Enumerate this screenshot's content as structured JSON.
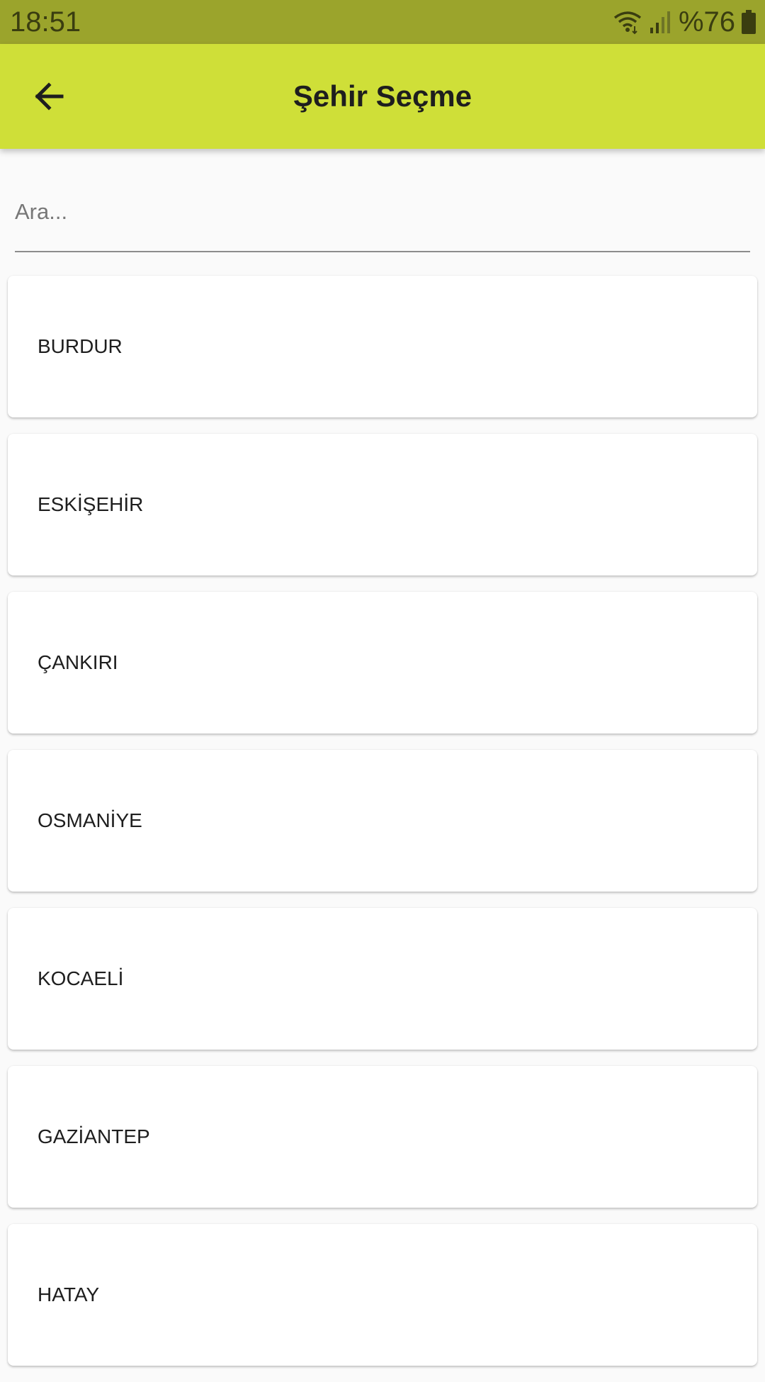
{
  "status_bar": {
    "time": "18:51",
    "battery_percent": "%76",
    "icons": [
      "wifi-icon",
      "cellular-signal-icon",
      "battery-icon"
    ]
  },
  "app_bar": {
    "title": "Şehir Seçme",
    "back_icon": "arrow-left-icon",
    "background_color": "#cfdf38"
  },
  "search": {
    "placeholder": "Ara...",
    "value": ""
  },
  "cities": [
    "BURDUR",
    "ESKİŞEHİR",
    "ÇANKIRI",
    "OSMANİYE",
    "KOCAELİ",
    "GAZİANTEP",
    "HATAY"
  ]
}
